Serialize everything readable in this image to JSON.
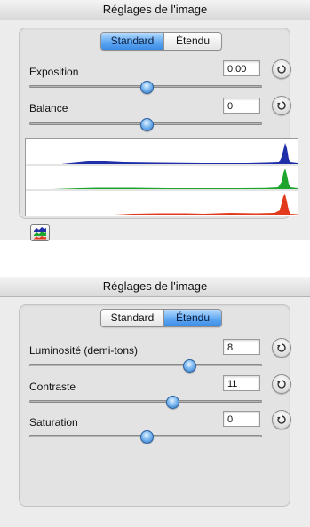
{
  "panels": [
    {
      "title": "Réglages de l'image",
      "tabs": [
        {
          "label": "Standard",
          "active": true
        },
        {
          "label": "Étendu",
          "active": false
        }
      ],
      "controls": [
        {
          "label": "Exposition",
          "value": "0.00",
          "slider_fraction": 0.5
        },
        {
          "label": "Balance",
          "value": "0",
          "slider_fraction": 0.5
        }
      ],
      "histogram": {
        "channels": [
          {
            "name": "blue",
            "color": "#1f2fa8"
          },
          {
            "name": "green",
            "color": "#1ea52e"
          },
          {
            "name": "red",
            "color": "#e23a1c"
          }
        ]
      },
      "histogram_button_icon": "histogram-icon"
    },
    {
      "title": "Réglages de l'image",
      "tabs": [
        {
          "label": "Standard",
          "active": false
        },
        {
          "label": "Étendu",
          "active": true
        }
      ],
      "controls": [
        {
          "label": "Luminosité (demi-tons)",
          "value": "8",
          "slider_fraction": 0.68
        },
        {
          "label": "Contraste",
          "value": "11",
          "slider_fraction": 0.61
        },
        {
          "label": "Saturation",
          "value": "0",
          "slider_fraction": 0.5
        }
      ]
    }
  ],
  "icons": {
    "revert": "revert-icon",
    "histogram": "histogram-icon"
  },
  "colors": {
    "accent": "#3b8be6",
    "thumb": "#2d74c6",
    "blue_channel": "#1f2fa8",
    "green_channel": "#1ea52e",
    "red_channel": "#e23a1c"
  }
}
